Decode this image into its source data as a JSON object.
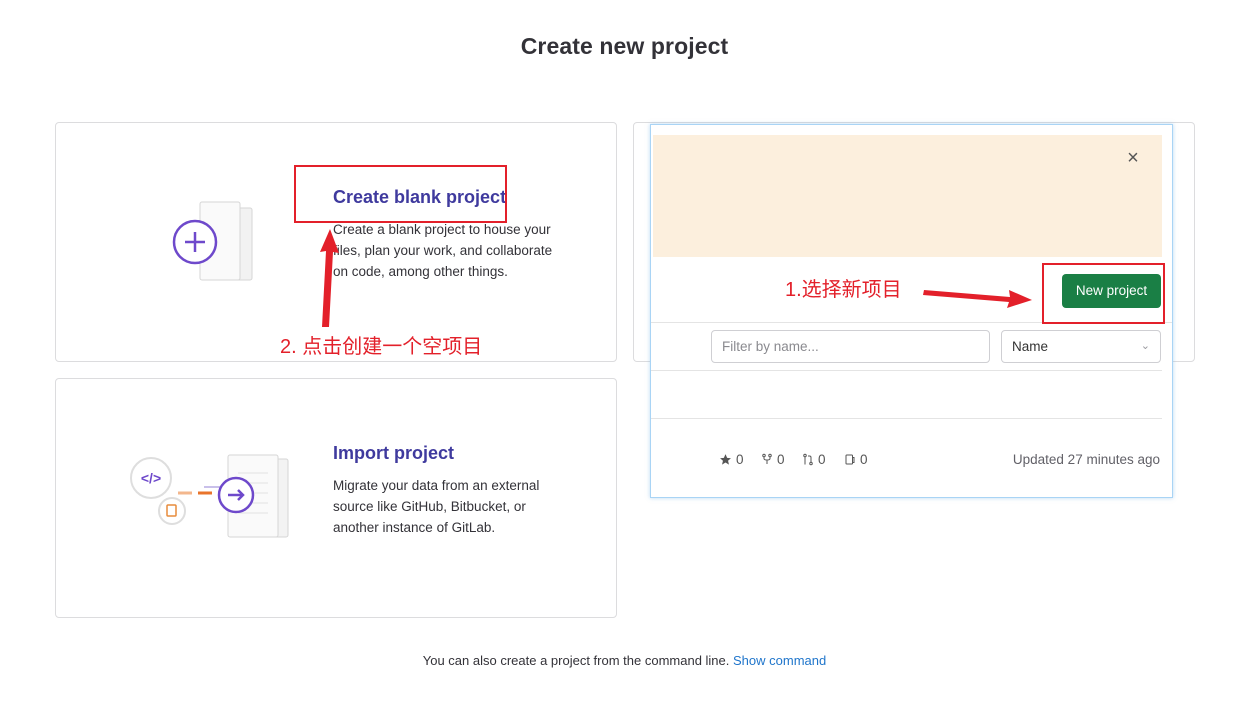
{
  "page": {
    "title": "Create new project"
  },
  "blank_card": {
    "title": "Create blank project",
    "description": "Create a blank project to house your files, plan your work, and collaborate on code, among other things."
  },
  "import_card": {
    "title": "Import project",
    "description": "Migrate your data from an external source like GitHub, Bitbucket, or another instance of GitLab."
  },
  "popup": {
    "close_icon": "×",
    "new_project_label": "New project",
    "filter_placeholder": "Filter by name...",
    "sort_value": "Name",
    "stats": {
      "stars": "0",
      "forks": "0",
      "merge_requests": "0",
      "issues": "0"
    },
    "updated": "Updated 27 minutes ago"
  },
  "annotations": {
    "step1": "1.选择新项目",
    "step2": "2. 点击创建一个空项目",
    "color": "#e3202a"
  },
  "footer": {
    "text": "You can also create a project from the command line.",
    "link": "Show command"
  },
  "colors": {
    "accent": "#3f3a9e",
    "primary_button": "#1a7f45",
    "link": "#1f75cb"
  }
}
